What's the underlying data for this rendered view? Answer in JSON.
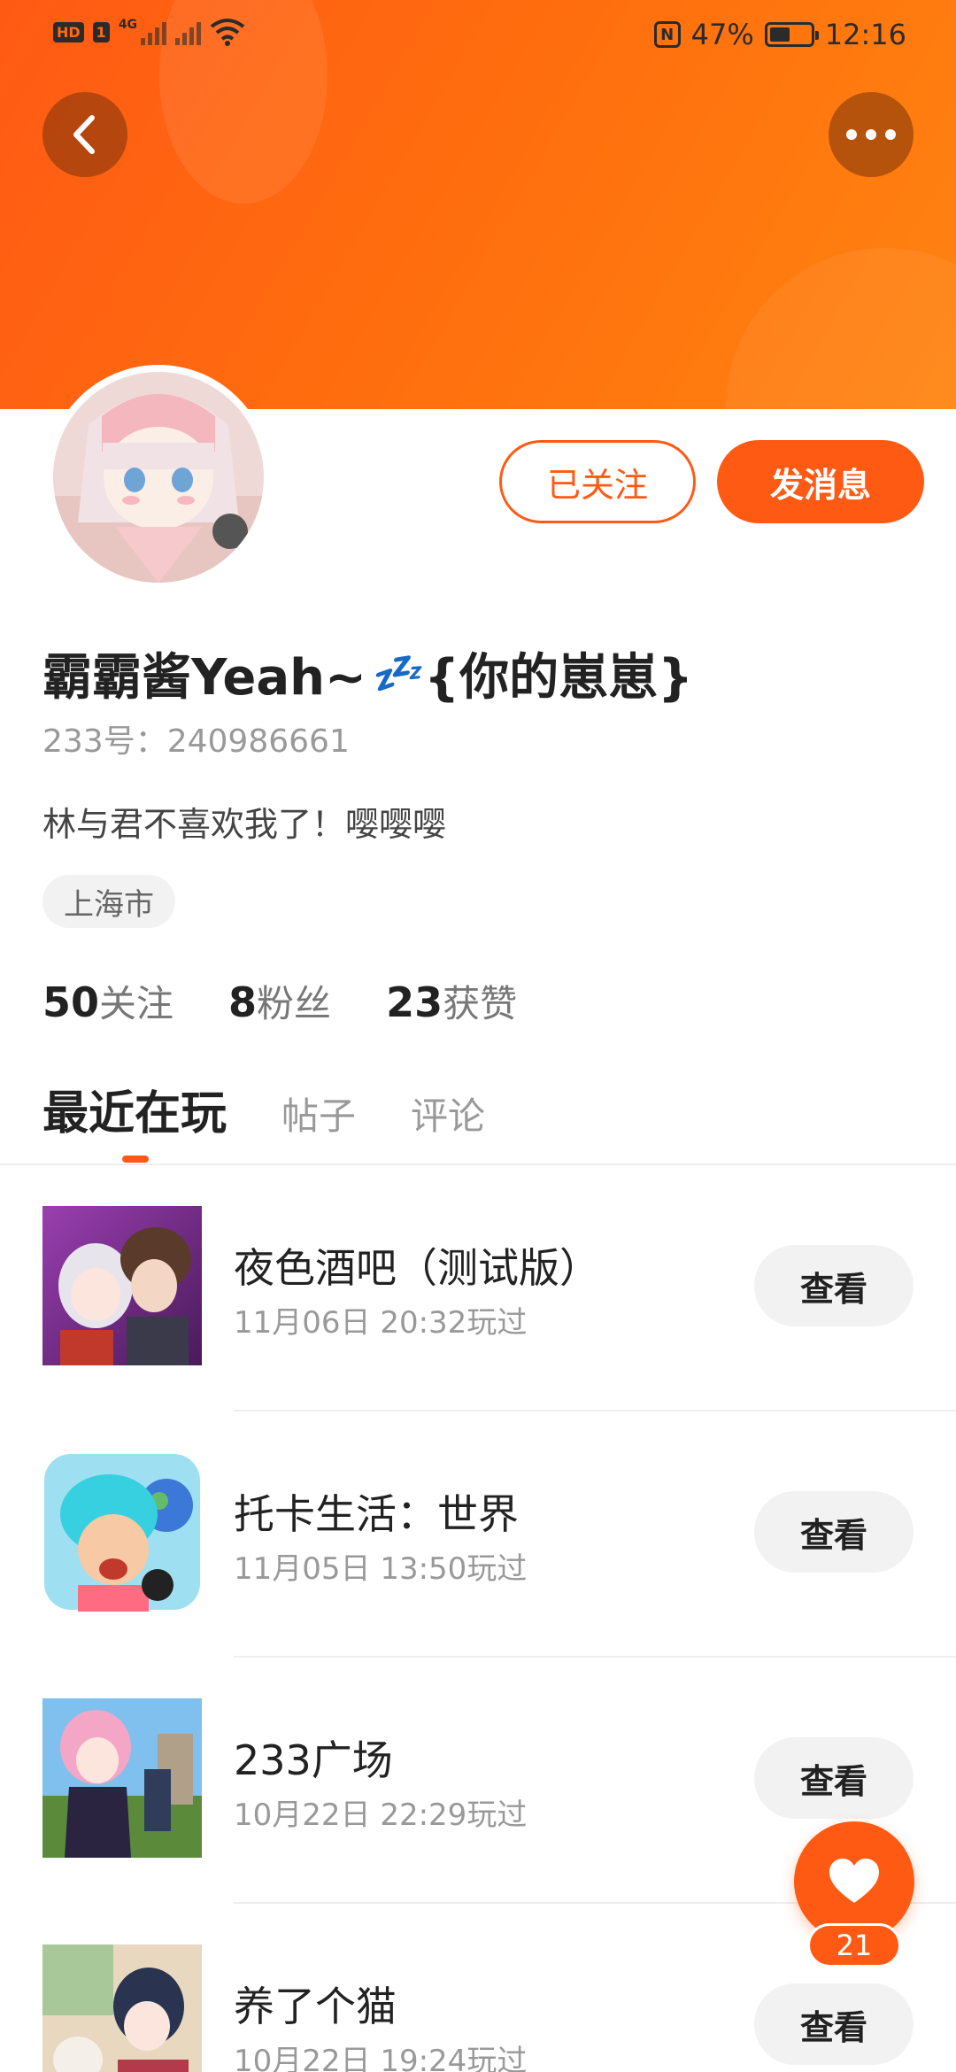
{
  "status_bar": {
    "left_badge": "HD",
    "left_sim": "1",
    "network": "4G",
    "nfc": "N",
    "battery": "47%",
    "time": "12:16"
  },
  "header": {
    "back_icon": "chevron-left-icon",
    "more_icon": "more-dots-icon"
  },
  "profile": {
    "follow_label": "已关注",
    "message_label": "发消息",
    "nickname_before": "霸霸酱Yeah~",
    "nickname_zzz": "💤",
    "nickname_after": "{你的崽崽}",
    "uid": "233号：240986661",
    "bio": "林与君不喜欢我了！嘤嘤嘤",
    "location": "上海市",
    "stats": {
      "following_count": "50",
      "following_label": "关注",
      "fans_count": "8",
      "fans_label": "粉丝",
      "likes_count": "23",
      "likes_label": "获赞"
    }
  },
  "tabs": {
    "recent": "最近在玩",
    "posts": "帖子",
    "comments": "评论"
  },
  "games": [
    {
      "name": "夜色酒吧（测试版）",
      "time": "11月06日 20:32玩过",
      "button": "查看"
    },
    {
      "name": "托卡生活：世界",
      "time": "11月05日 13:50玩过",
      "button": "查看"
    },
    {
      "name": "233广场",
      "time": "10月22日 22:29玩过",
      "button": "查看"
    },
    {
      "name": "养了个猫",
      "time": "10月22日 19:24玩过",
      "button": "查看"
    }
  ],
  "like_fab": {
    "icon": "heart-icon",
    "count": "21"
  },
  "colors": {
    "accent": "#ff5a14",
    "banner_start": "#ff5a14",
    "banner_end": "#ff8410"
  }
}
